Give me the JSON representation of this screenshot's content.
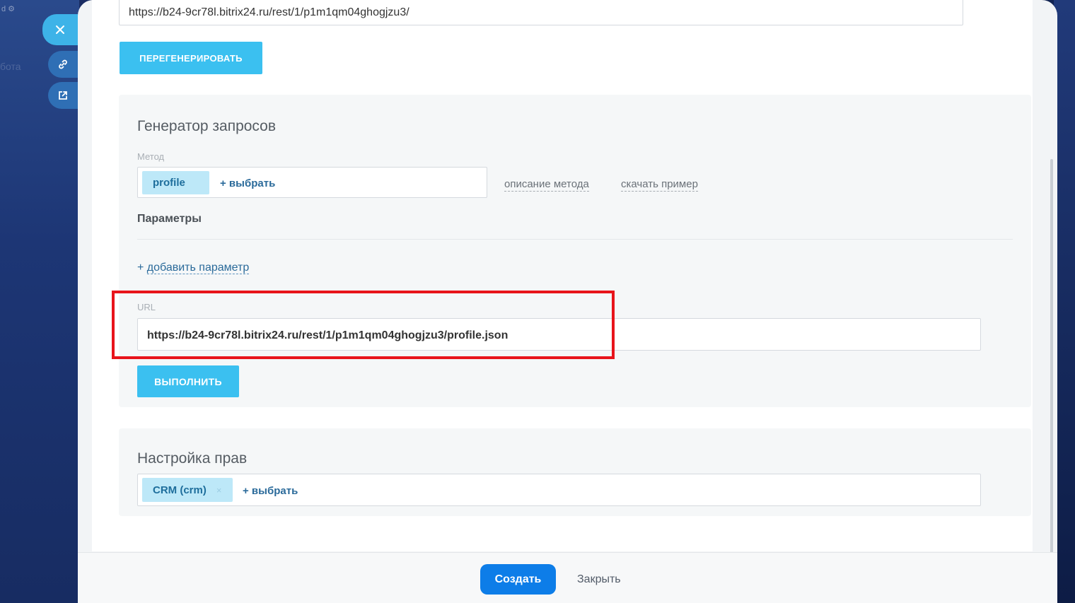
{
  "background": {
    "faded_text": "бота"
  },
  "webhook": {
    "url": "https://b24-9cr78l.bitrix24.ru/rest/1/p1m1qm04ghogjzu3/",
    "regenerate_label": "ПЕРЕГЕНЕРИРОВАТЬ"
  },
  "generator": {
    "title": "Генератор запросов",
    "method_label": "Метод",
    "method_tag": "profile",
    "method_add": "+ выбрать",
    "method_description_link": "описание метода",
    "download_example_link": "скачать пример",
    "params_title": "Параметры",
    "add_param_plus": "+",
    "add_param_label": "добавить параметр",
    "url_label": "URL",
    "url_value": "https://b24-9cr78l.bitrix24.ru/rest/1/p1m1qm04ghogjzu3/profile.json",
    "run_label": "ВЫПОЛНИТЬ"
  },
  "rights": {
    "title": "Настройка прав",
    "tag": "CRM (crm)",
    "tag_remove": "×",
    "add": "+ выбрать"
  },
  "footer": {
    "create_label": "Создать",
    "close_label": "Закрыть"
  },
  "colors": {
    "accent": "#3bc0f0",
    "primary": "#0d7de8",
    "highlight": "#e8141b",
    "tag_bg": "#bde8f8"
  },
  "icons": {
    "close": "close-icon",
    "link": "link-icon",
    "open": "open-external-icon"
  }
}
